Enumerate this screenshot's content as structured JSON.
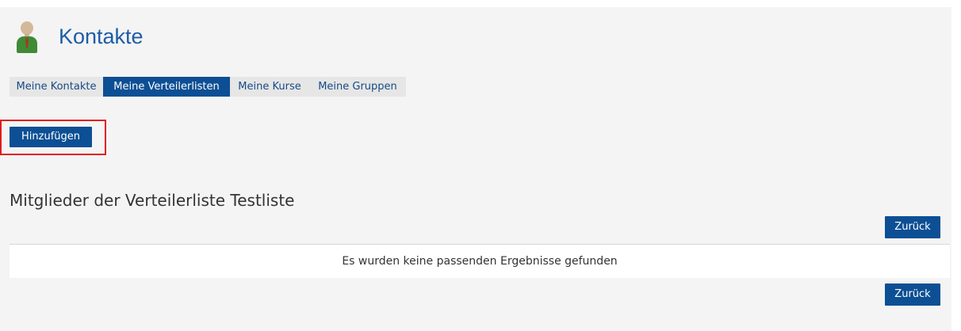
{
  "page": {
    "title": "Kontakte",
    "icon": "contact-person-icon"
  },
  "tabs": [
    {
      "label": "Meine Kontakte",
      "active": false
    },
    {
      "label": "Meine Verteilerlisten",
      "active": true
    },
    {
      "label": "Meine Kurse",
      "active": false
    },
    {
      "label": "Meine Gruppen",
      "active": false
    }
  ],
  "actions": {
    "add_label": "Hinzufügen"
  },
  "section": {
    "title": "Mitglieder der Verteilerliste Testliste",
    "back_label": "Zurück",
    "empty_message": "Es wurden keine passenden Ergebnisse gefunden"
  },
  "colors": {
    "accent": "#0d4f94",
    "title": "#1d5da6",
    "highlight": "#e31b1b",
    "panel_background": "#f4f4f4"
  }
}
